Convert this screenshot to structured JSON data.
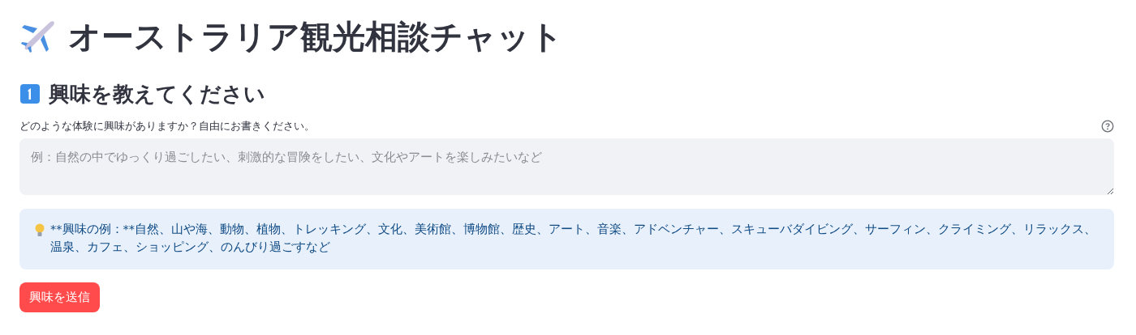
{
  "title": "オーストラリア観光相談チャット",
  "section": {
    "heading": "興味を教えてください"
  },
  "interest_field": {
    "label": "どのような体験に興味がありますか？自由にお書きください。",
    "placeholder": "例：自然の中でゆっくり過ごしたい、刺激的な冒険をしたい、文化やアートを楽しみたいなど"
  },
  "info": {
    "text": "**興味の例：**自然、山や海、動物、植物、トレッキング、文化、美術館、博物館、歴史、アート、音楽、アドベンチャー、スキューバダイビング、サーフィン、クライミング、リラックス、温泉、カフェ、ショッピング、のんびり過ごすなど"
  },
  "submit_button": {
    "label": "興味を送信"
  }
}
